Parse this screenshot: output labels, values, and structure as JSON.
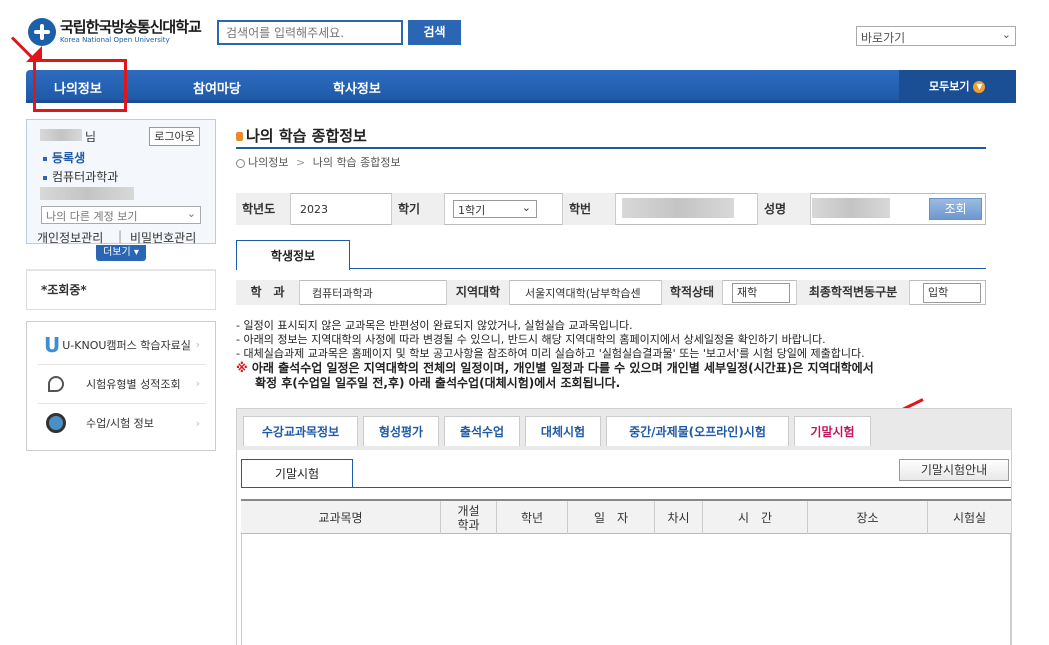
{
  "header": {
    "logo_ko": "국립한국방송통신대학교",
    "logo_en": "Korea National Open University",
    "search_placeholder": "검색어를 입력해주세요.",
    "search_button": "검색",
    "quick_nav": "바로가기"
  },
  "nav": {
    "items": [
      "나의정보",
      "참여마당",
      "학사정보"
    ],
    "view_all": "모두보기"
  },
  "sidebar": {
    "user_suffix": "님",
    "logout": "로그아웃",
    "status": "등록생",
    "dept": "컴퓨터과학과",
    "other_account": "나의 다른 계정 보기",
    "personal_info": "개인정보관리",
    "password": "비밀번호관리",
    "more": "더보기",
    "inquiry": "*조회중*",
    "links": [
      {
        "label": "U-KNOU캠퍼스 학습자료실",
        "icon": "u-knou-logo-icon"
      },
      {
        "label": "시험유형별 성적조회",
        "icon": "pen-icon"
      },
      {
        "label": "수업/시험 정보",
        "icon": "headset-icon"
      }
    ]
  },
  "main": {
    "title": "나의 학습 종합정보",
    "breadcrumb": [
      "나의정보",
      "나의 학습 종합정보"
    ],
    "filter": {
      "year_label": "학년도",
      "year_value": "2023",
      "semester_label": "학기",
      "semester_value": "1학기",
      "student_no_label": "학번",
      "name_label": "성명",
      "query_button": "조회"
    },
    "student_tab": "학생정보",
    "info": {
      "dept_label": "학　과",
      "dept_value": "컴퓨터과학과",
      "region_label": "지역대학",
      "region_value": "서울지역대학(남부학습센",
      "status_label": "학적상태",
      "status_value": "재학",
      "change_label": "최종학적변동구분",
      "change_value": "입학"
    },
    "notes": [
      "- 일정이 표시되지 않은 교과목은 반편성이 완료되지 않았거나, 실험실습 교과목입니다.",
      "- 아래의 정보는 지역대학의 사정에 따라 변경될 수 있으니, 반드시 해당 지역대학의 홈페이지에서 상세일정을 확인하기 바랍니다.",
      "- 대체실습과제 교과목은 홈페이지 및 학보 공고사항을 참조하여 미리 실습하고 '실험실습결과물' 또는 '보고서'를 시험 당일에 제출합니다."
    ],
    "note_mark": "※",
    "note_bold_1": "아래 출석수업 일정은 지역대학의 전체의 일정이며, 개인별 일정과 다를 수 있으며 개인별 세부일정(시간표)은 지역대학에서",
    "note_bold_2": "확정 후(수업일 일주일 전,후) 아래 출석수업(대체시험)에서 조회됩니다.",
    "tabs": [
      "수강교과목정보",
      "형성평가",
      "출석수업",
      "대체시험",
      "중간/과제물(오프라인)시험",
      "기말시험"
    ],
    "active_tab": "기말시험",
    "section_tab": "기말시험",
    "guide_button": "기말시험안내",
    "columns": [
      "교과목명",
      "개설\n학과",
      "학년",
      "일　자",
      "차시",
      "시　간",
      "장소",
      "시험실"
    ]
  },
  "colors": {
    "brand_blue": "#1f5aa8",
    "annotation_red": "#e0161b",
    "active_tab_text": "#c4145c"
  }
}
